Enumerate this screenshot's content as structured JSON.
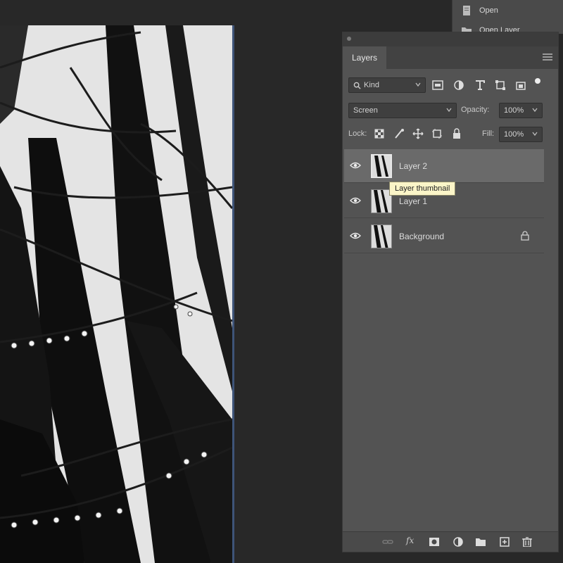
{
  "menu": {
    "items": [
      {
        "label": "Open",
        "icon": "document-icon"
      },
      {
        "label": "Open Layer",
        "icon": "folder-icon"
      }
    ]
  },
  "panel": {
    "tab": "Layers",
    "filter": {
      "kind_label": "Kind"
    },
    "blend_mode": "Screen",
    "opacity_label": "Opacity:",
    "opacity_value": "100%",
    "lock_label": "Lock:",
    "fill_label": "Fill:",
    "fill_value": "100%",
    "layers": [
      {
        "name": "Layer 2",
        "selected": true,
        "visible": true
      },
      {
        "name": "Layer 1",
        "selected": false,
        "visible": true
      },
      {
        "name": "Background",
        "selected": false,
        "visible": true,
        "locked": true
      }
    ],
    "tooltip": "Layer thumbnail"
  },
  "colors": {
    "app_bg": "#282828",
    "panel_bg": "#535353",
    "selected_row": "#6a6a6a",
    "tooltip_bg": "#fbf5c8",
    "canvas_border": "#3e5478"
  }
}
